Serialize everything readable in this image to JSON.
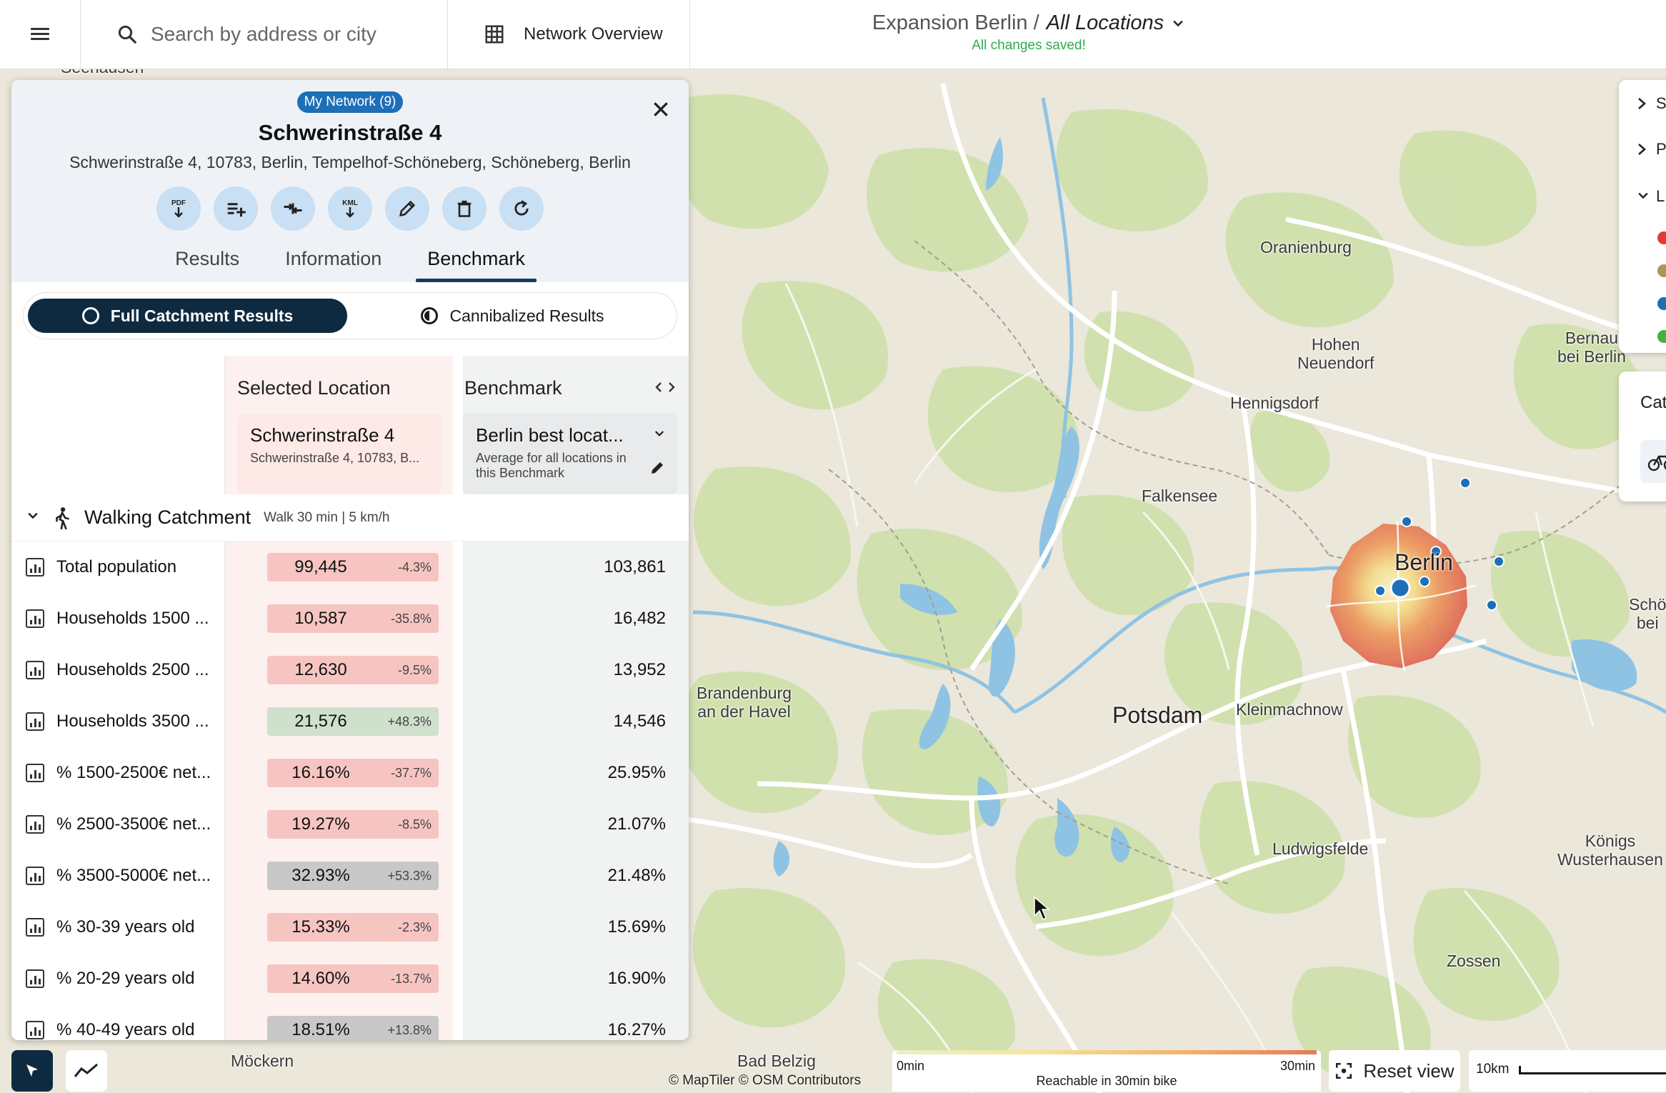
{
  "topbar": {
    "search_placeholder": "Search by address or city",
    "network_overview": "Network Overview",
    "project": "Expansion Berlin /",
    "scope": "All Locations",
    "saved_status": "All changes saved!"
  },
  "panel": {
    "badge": "My Network (9)",
    "title": "Schwerinstraße 4",
    "address": "Schwerinstraße 4, 10783, Berlin, Tempelhof-Schöneberg, Schöneberg, Berlin",
    "actions": [
      {
        "icon": "pdf-download-icon",
        "label": "PDF"
      },
      {
        "icon": "add-to-list-icon",
        "label": ""
      },
      {
        "icon": "compare-icon",
        "label": ""
      },
      {
        "icon": "kml-download-icon",
        "label": "KML"
      },
      {
        "icon": "edit-icon",
        "label": ""
      },
      {
        "icon": "delete-icon",
        "label": ""
      },
      {
        "icon": "refresh-icon",
        "label": ""
      }
    ],
    "tabs": [
      "Results",
      "Information",
      "Benchmark"
    ],
    "active_tab": "Benchmark",
    "toggle": {
      "full": "Full Catchment Results",
      "cannibalized": "Cannibalized Results",
      "active": "full"
    },
    "table": {
      "col_selected": "Selected Location",
      "col_benchmark": "Benchmark",
      "selected_card": {
        "title": "Schwerinstraße 4",
        "subtitle": "Schwerinstraße 4, 10783, B..."
      },
      "benchmark_card": {
        "title": "Berlin best locat...",
        "subtitle": "Average for all locations in this Benchmark"
      },
      "section": {
        "title": "Walking Catchment",
        "subtitle": "Walk 30 min | 5 km/h"
      },
      "rows": [
        {
          "label": "Total population",
          "value": "99,445",
          "delta": "-4.3%",
          "tone": "red",
          "benchmark": "103,861"
        },
        {
          "label": "Households 1500 ...",
          "value": "10,587",
          "delta": "-35.8%",
          "tone": "red",
          "benchmark": "16,482"
        },
        {
          "label": "Households 2500 ...",
          "value": "12,630",
          "delta": "-9.5%",
          "tone": "red",
          "benchmark": "13,952"
        },
        {
          "label": "Households 3500 ...",
          "value": "21,576",
          "delta": "+48.3%",
          "tone": "green",
          "benchmark": "14,546"
        },
        {
          "label": "% 1500-2500€ net...",
          "value": "16.16%",
          "delta": "-37.7%",
          "tone": "red",
          "benchmark": "25.95%"
        },
        {
          "label": "% 2500-3500€ net...",
          "value": "19.27%",
          "delta": "-8.5%",
          "tone": "red",
          "benchmark": "21.07%"
        },
        {
          "label": "% 3500-5000€ net...",
          "value": "32.93%",
          "delta": "+53.3%",
          "tone": "gray",
          "benchmark": "21.48%"
        },
        {
          "label": "% 30-39 years old",
          "value": "15.33%",
          "delta": "-2.3%",
          "tone": "red",
          "benchmark": "15.69%"
        },
        {
          "label": "% 20-29 years old",
          "value": "14.60%",
          "delta": "-13.7%",
          "tone": "red",
          "benchmark": "16.90%"
        },
        {
          "label": "% 40-49 years old",
          "value": "18.51%",
          "delta": "+13.8%",
          "tone": "gray",
          "benchmark": "16.27%"
        }
      ]
    }
  },
  "map": {
    "labels": {
      "seehausen": "Seehausen",
      "oranienburg": "Oranienburg",
      "hohen_neuendorf": "Hohen\nNeuendorf",
      "hennigsdorf": "Hennigsdorf",
      "bernau": "Bernau\nbei Berlin",
      "falkensee": "Falkensee",
      "berlin": "Berlin",
      "brandenburg": "Brandenburg\nan der Havel",
      "potsdam": "Potsdam",
      "kleinmachnow": "Kleinmachnow",
      "schoene": "Schö\nbei",
      "koenigs": "Königs\nWusterhausen",
      "ludwigsfelde": "Ludwigsfelde",
      "zossen": "Zossen",
      "moeckern": "Möckern",
      "bad_belzig": "Bad Belzig"
    },
    "attribution": "© MapTiler  © OSM Contributors",
    "legend": {
      "min": "0min",
      "max": "30min",
      "caption": "Reachable in 30min bike"
    },
    "reset_view": "Reset view",
    "scale": "10km"
  },
  "right_drawer": {
    "items": [
      "S",
      "P",
      "L"
    ],
    "dot_colors": [
      "#e53935",
      "#b0945a",
      "#1d6fb8",
      "#3fb43f"
    ],
    "catchment_label": "Cat"
  },
  "colors": {
    "accent": "#1d6fb8",
    "saved": "#2faa4f",
    "active_toggle": "#0e2a40"
  }
}
